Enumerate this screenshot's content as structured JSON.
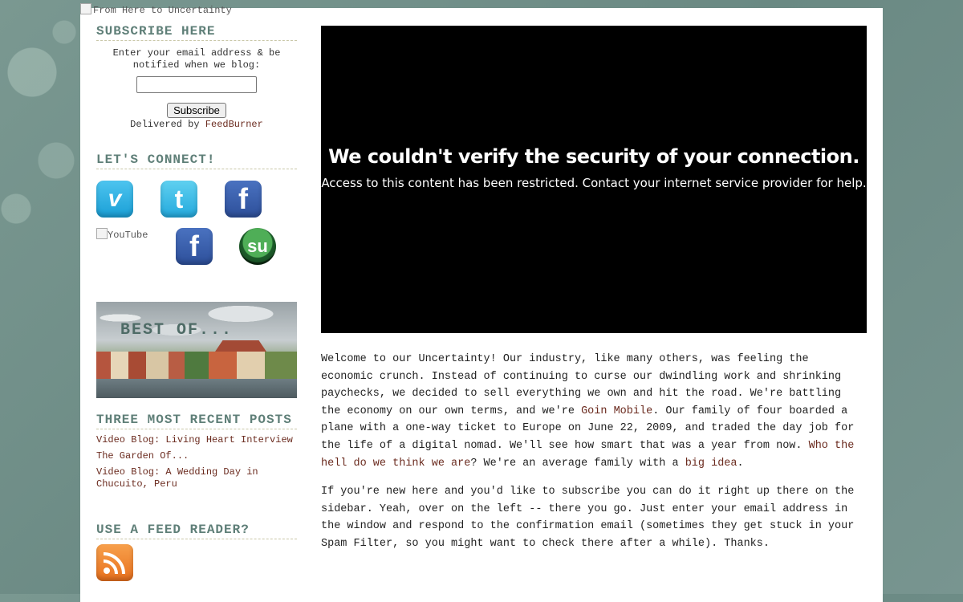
{
  "header": {
    "image_alt": "From Here to Uncertainty"
  },
  "sidebar": {
    "subscribe": {
      "title": "SUBSCRIBE HERE",
      "text": "Enter your email address & be notified when we blog:",
      "email_value": "",
      "button_label": "Subscribe",
      "delivered_prefix": "Delivered by ",
      "delivered_link": "FeedBurner"
    },
    "connect": {
      "title": "LET'S CONNECT!",
      "icons": [
        "vimeo-icon",
        "twitter-icon",
        "facebook-icon",
        "youtube-icon",
        "facebook-icon",
        "stumbleupon-icon"
      ],
      "youtube_alt": "YouTube"
    },
    "best_of": {
      "label": "BEST OF..."
    },
    "recent": {
      "title": "THREE MOST RECENT POSTS",
      "posts": [
        "Video Blog: Living Heart Interview",
        "The Garden Of...",
        "Video Blog: A Wedding Day in Chucuito, Peru"
      ]
    },
    "feed": {
      "title": "USE A FEED READER?"
    }
  },
  "main": {
    "video": {
      "title": "We couldn't verify the security of your connection.",
      "message": "Access to this content has been restricted. Contact your internet service provider for help."
    },
    "post": {
      "p1_a": "Welcome to our Uncertainty! Our industry, like many others, was feeling the economic crunch. Instead of continuing to curse our dwindling work and shrinking paychecks, we decided to sell everything we own and hit the road. We're battling the economy on our own terms, and we're ",
      "p1_link1": "Goin Mobile",
      "p1_b": ". Our family of four boarded a plane with a one-way ticket to Europe on June 22, 2009, and traded the day job for the life of a digital nomad. We'll see how smart that was a year from now. ",
      "p1_link2": "Who the hell do we think we are",
      "p1_c": "? We're an average family with a ",
      "p1_link3": "big idea",
      "p1_d": ".",
      "p2": "If you're new here and you'd like to subscribe you can do it right up there on the sidebar. Yeah, over on the left -- there you go. Just enter your email address in the window and respond to the confirmation email (sometimes they get stuck in your Spam Filter, so you might want to check there after a while). Thanks."
    }
  },
  "colors": {
    "background": "#6f8f88",
    "widget_title": "#5f7f78",
    "link": "#6b2b1f",
    "video_bg": "#000000"
  }
}
